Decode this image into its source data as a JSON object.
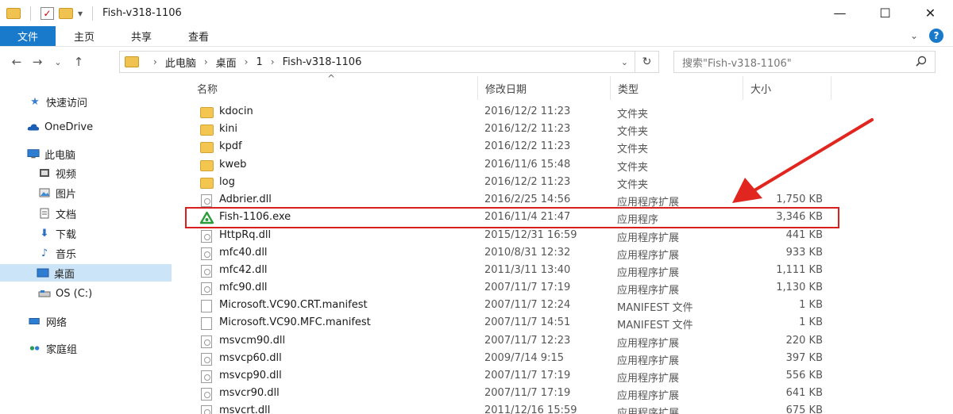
{
  "window": {
    "title": "Fish-v318-1106",
    "controls": {
      "minimize": "—",
      "maximize": "☐",
      "close": "✕"
    }
  },
  "ribbon": {
    "tabs": [
      "文件",
      "主页",
      "共享",
      "查看"
    ],
    "active_tab": "文件",
    "accent_color": "#1979ca"
  },
  "address": {
    "crumbs": [
      "此电脑",
      "桌面",
      "1",
      "Fish-v318-1106"
    ],
    "search_placeholder": "搜索\"Fish-v318-1106\""
  },
  "sidebar": {
    "items": [
      {
        "label": "快速访问",
        "icon": "star-icon"
      },
      {
        "label": "OneDrive",
        "icon": "cloud-icon"
      },
      {
        "label": "此电脑",
        "icon": "computer-icon"
      },
      {
        "label": "视频",
        "icon": "video-icon"
      },
      {
        "label": "图片",
        "icon": "picture-icon"
      },
      {
        "label": "文档",
        "icon": "document-icon"
      },
      {
        "label": "下载",
        "icon": "download-icon"
      },
      {
        "label": "音乐",
        "icon": "music-icon"
      },
      {
        "label": "桌面",
        "icon": "desktop-icon",
        "selected": true
      },
      {
        "label": "OS (C:)",
        "icon": "drive-icon"
      },
      {
        "label": "网络",
        "icon": "network-icon"
      },
      {
        "label": "家庭组",
        "icon": "homegroup-icon"
      }
    ]
  },
  "columns": {
    "name": "名称",
    "date": "修改日期",
    "type": "类型",
    "size": "大小"
  },
  "files": [
    {
      "name": "kdocin",
      "date": "2016/12/2 11:23",
      "type": "文件夹",
      "size": "",
      "kind": "folder"
    },
    {
      "name": "kini",
      "date": "2016/12/2 11:23",
      "type": "文件夹",
      "size": "",
      "kind": "folder"
    },
    {
      "name": "kpdf",
      "date": "2016/12/2 11:23",
      "type": "文件夹",
      "size": "",
      "kind": "folder"
    },
    {
      "name": "kweb",
      "date": "2016/11/6 15:48",
      "type": "文件夹",
      "size": "",
      "kind": "folder"
    },
    {
      "name": "log",
      "date": "2016/12/2 11:23",
      "type": "文件夹",
      "size": "",
      "kind": "folder"
    },
    {
      "name": "Adbrier.dll",
      "date": "2016/2/25 14:56",
      "type": "应用程序扩展",
      "size": "1,750 KB",
      "kind": "dll"
    },
    {
      "name": "Fish-1106.exe",
      "date": "2016/11/4 21:47",
      "type": "应用程序",
      "size": "3,346 KB",
      "kind": "exe"
    },
    {
      "name": "HttpRq.dll",
      "date": "2015/12/31 16:59",
      "type": "应用程序扩展",
      "size": "441 KB",
      "kind": "dll"
    },
    {
      "name": "mfc40.dll",
      "date": "2010/8/31 12:32",
      "type": "应用程序扩展",
      "size": "933 KB",
      "kind": "dll"
    },
    {
      "name": "mfc42.dll",
      "date": "2011/3/11 13:40",
      "type": "应用程序扩展",
      "size": "1,111 KB",
      "kind": "dll"
    },
    {
      "name": "mfc90.dll",
      "date": "2007/11/7 17:19",
      "type": "应用程序扩展",
      "size": "1,130 KB",
      "kind": "dll"
    },
    {
      "name": "Microsoft.VC90.CRT.manifest",
      "date": "2007/11/7 12:24",
      "type": "MANIFEST 文件",
      "size": "1 KB",
      "kind": "doc"
    },
    {
      "name": "Microsoft.VC90.MFC.manifest",
      "date": "2007/11/7 14:51",
      "type": "MANIFEST 文件",
      "size": "1 KB",
      "kind": "doc"
    },
    {
      "name": "msvcm90.dll",
      "date": "2007/11/7 12:23",
      "type": "应用程序扩展",
      "size": "220 KB",
      "kind": "dll"
    },
    {
      "name": "msvcp60.dll",
      "date": "2009/7/14 9:15",
      "type": "应用程序扩展",
      "size": "397 KB",
      "kind": "dll"
    },
    {
      "name": "msvcp90.dll",
      "date": "2007/11/7 17:19",
      "type": "应用程序扩展",
      "size": "556 KB",
      "kind": "dll"
    },
    {
      "name": "msvcr90.dll",
      "date": "2007/11/7 17:19",
      "type": "应用程序扩展",
      "size": "641 KB",
      "kind": "dll"
    },
    {
      "name": "msvcrt.dll",
      "date": "2011/12/16 15:59",
      "type": "应用程序扩展",
      "size": "675 KB",
      "kind": "dll"
    }
  ],
  "highlight_color": "#d9201f"
}
